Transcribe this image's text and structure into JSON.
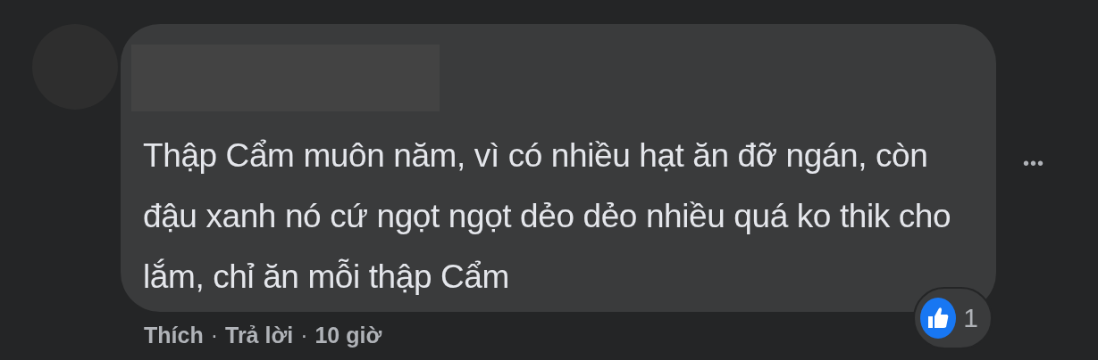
{
  "comment": {
    "text_lines": [
      "Thập Cẩm muôn năm, vì có nhiều hạt ăn đỡ ngán, còn",
      "đậu xanh nó cứ ngọt ngọt dẻo dẻo nhiều quá ko thik cho",
      "lắm, chỉ ăn mỗi thập Cẩm"
    ],
    "reaction_count": "1",
    "actions": [
      "Thích",
      "Trả lời"
    ],
    "separator": "·",
    "time": "10 giờ",
    "more": "•••"
  }
}
